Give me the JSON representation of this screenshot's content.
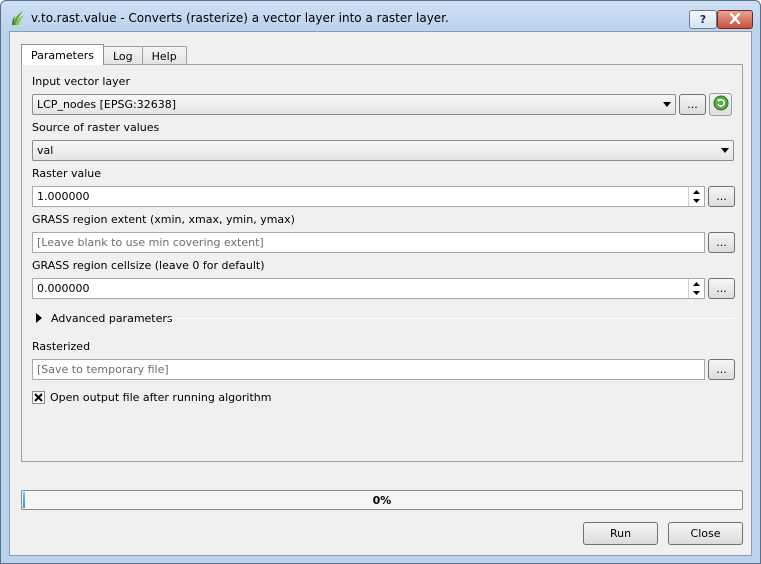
{
  "window": {
    "title": "v.to.rast.value - Converts (rasterize) a vector layer into a raster layer.",
    "help_label": "?",
    "icon": "qgis-grass-icon"
  },
  "tabs": [
    {
      "label": "Parameters",
      "active": true
    },
    {
      "label": "Log",
      "active": false
    },
    {
      "label": "Help",
      "active": false
    }
  ],
  "params": {
    "input_layer": {
      "label": "Input vector layer",
      "value": "LCP_nodes [EPSG:32638]"
    },
    "source": {
      "label": "Source of raster values",
      "value": "val"
    },
    "raster_value": {
      "label": "Raster value",
      "value": "1.000000"
    },
    "region_extent": {
      "label": "GRASS region extent (xmin, xmax, ymin, ymax)",
      "placeholder": "[Leave blank to use min covering extent]"
    },
    "cellsize": {
      "label": "GRASS region cellsize (leave 0 for default)",
      "value": "0.000000"
    },
    "advanced_label": "Advanced parameters",
    "output": {
      "label": "Rasterized",
      "placeholder": "[Save to temporary file]"
    },
    "open_output": {
      "label": "Open output file after running algorithm",
      "checked": true
    },
    "browse_label": "..."
  },
  "progress": {
    "text": "0%",
    "value": 0
  },
  "buttons": {
    "run": "Run",
    "close": "Close"
  },
  "colors": {
    "progress": "#2d8fdd",
    "accent": "#4a9b3a"
  }
}
